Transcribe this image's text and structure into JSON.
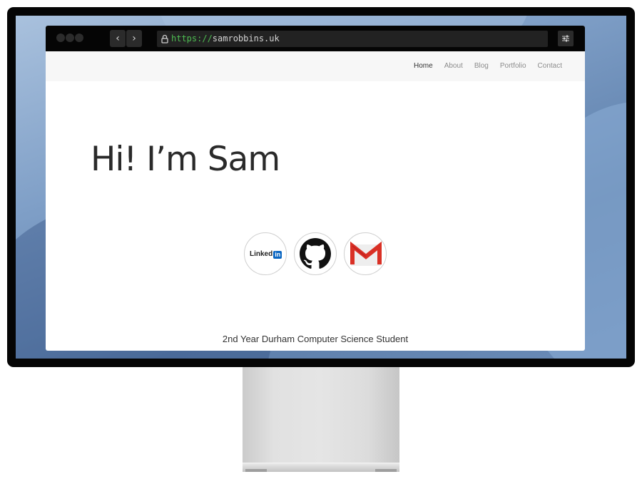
{
  "browser": {
    "url_scheme": "https://",
    "url_host": "samrobbins.uk",
    "back_icon": "chevron-left-icon",
    "forward_icon": "chevron-right-icon",
    "lock_icon": "lock-icon",
    "settings_icon": "sliders-icon"
  },
  "site": {
    "nav": [
      {
        "label": "Home",
        "active": true
      },
      {
        "label": "About",
        "active": false
      },
      {
        "label": "Blog",
        "active": false
      },
      {
        "label": "Portfolio",
        "active": false
      },
      {
        "label": "Contact",
        "active": false
      }
    ],
    "hero_title": "Hi! I’m Sam",
    "social": {
      "linkedin_text": "Linked",
      "linkedin_badge": "in"
    },
    "subtitle": "2nd Year Durham Computer Science Student"
  },
  "colors": {
    "linkedin_blue": "#0a66c2",
    "url_green": "#4ebd52",
    "gmail_red": "#d93025"
  }
}
